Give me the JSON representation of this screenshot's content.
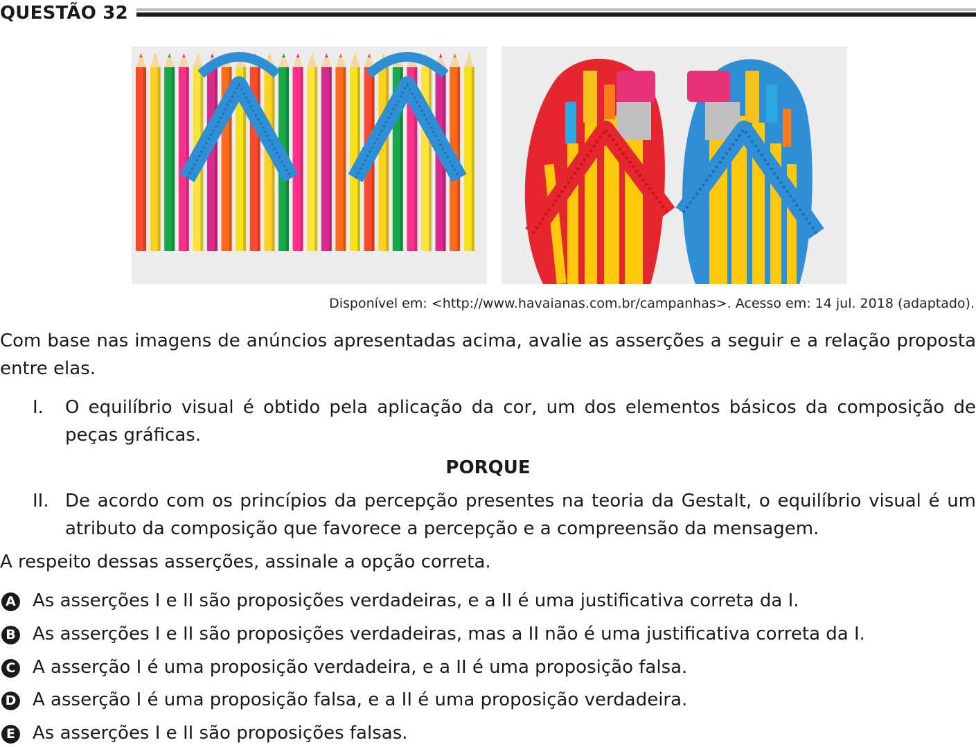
{
  "question": {
    "title": "QUESTÃO 32"
  },
  "images": {
    "left": {
      "alt": "colored-pencils-flip-flops"
    },
    "right": {
      "alt": "paintbrush-flip-flops"
    }
  },
  "source": "Disponível em: <http://www.havaianas.com.br/campanhas>. Acesso em: 14 jul. 2018 (adaptado).",
  "intro": "Com base nas imagens de anúncios apresentadas acima, avalie as asserções a seguir e a relação proposta entre elas.",
  "assertions": [
    {
      "num": "I.",
      "text": "O equilíbrio visual é obtido pela aplicação da cor, um dos elementos básicos da composição de peças gráficas."
    },
    {
      "num": "II.",
      "text": "De acordo com os princípios da percepção presentes na teoria da Gestalt, o equilíbrio visual é um atributo da composição que favorece a percepção e a compreensão da mensagem."
    }
  ],
  "connector": "PORQUE",
  "prompt": "A respeito dessas asserções, assinale a opção correta.",
  "options": [
    {
      "letter": "A",
      "text": "As asserções I e II são proposições verdadeiras, e a II é uma justificativa correta da I."
    },
    {
      "letter": "B",
      "text": "As asserções I e II são proposições verdadeiras, mas a II não é uma justificativa correta da I."
    },
    {
      "letter": "C",
      "text": "A asserção I é uma proposição verdadeira, e a II é uma proposição falsa."
    },
    {
      "letter": "D",
      "text": "A asserção I é uma proposição falsa, e a II é uma proposição verdadeira."
    },
    {
      "letter": "E",
      "text": "As asserções I e II são proposições falsas."
    }
  ],
  "colors": {
    "pencils": [
      "#ff4b2b",
      "#ffd21f",
      "#19a84a",
      "#ff2f8a",
      "#ffe23a",
      "#d92a8f",
      "#ff6a1a",
      "#f7e11a"
    ],
    "strap_blue": "#2f8fd6",
    "strap_red": "#e5262e",
    "brush_yellow": "#ffc80a"
  }
}
